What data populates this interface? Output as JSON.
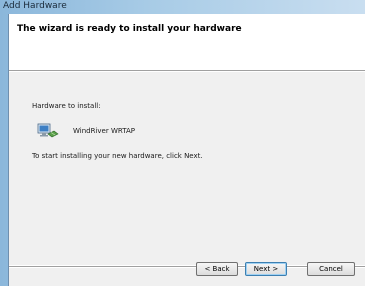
{
  "window": {
    "title": "Add Hardware"
  },
  "header": {
    "title": "The wizard is ready to install your hardware"
  },
  "content": {
    "hardware_label": "Hardware to install:",
    "hardware_name": "WindRiver WRTAP",
    "hardware_icon": "network-adapter-icon",
    "instructions": "To start installing your new hardware, click Next."
  },
  "buttons": {
    "back": "< Back",
    "next": "Next >",
    "cancel": "Cancel"
  },
  "colors": {
    "title_bar": "#a7cbe6",
    "content_bg": "#f0f0f0",
    "next_border": "#3c7fb1"
  }
}
